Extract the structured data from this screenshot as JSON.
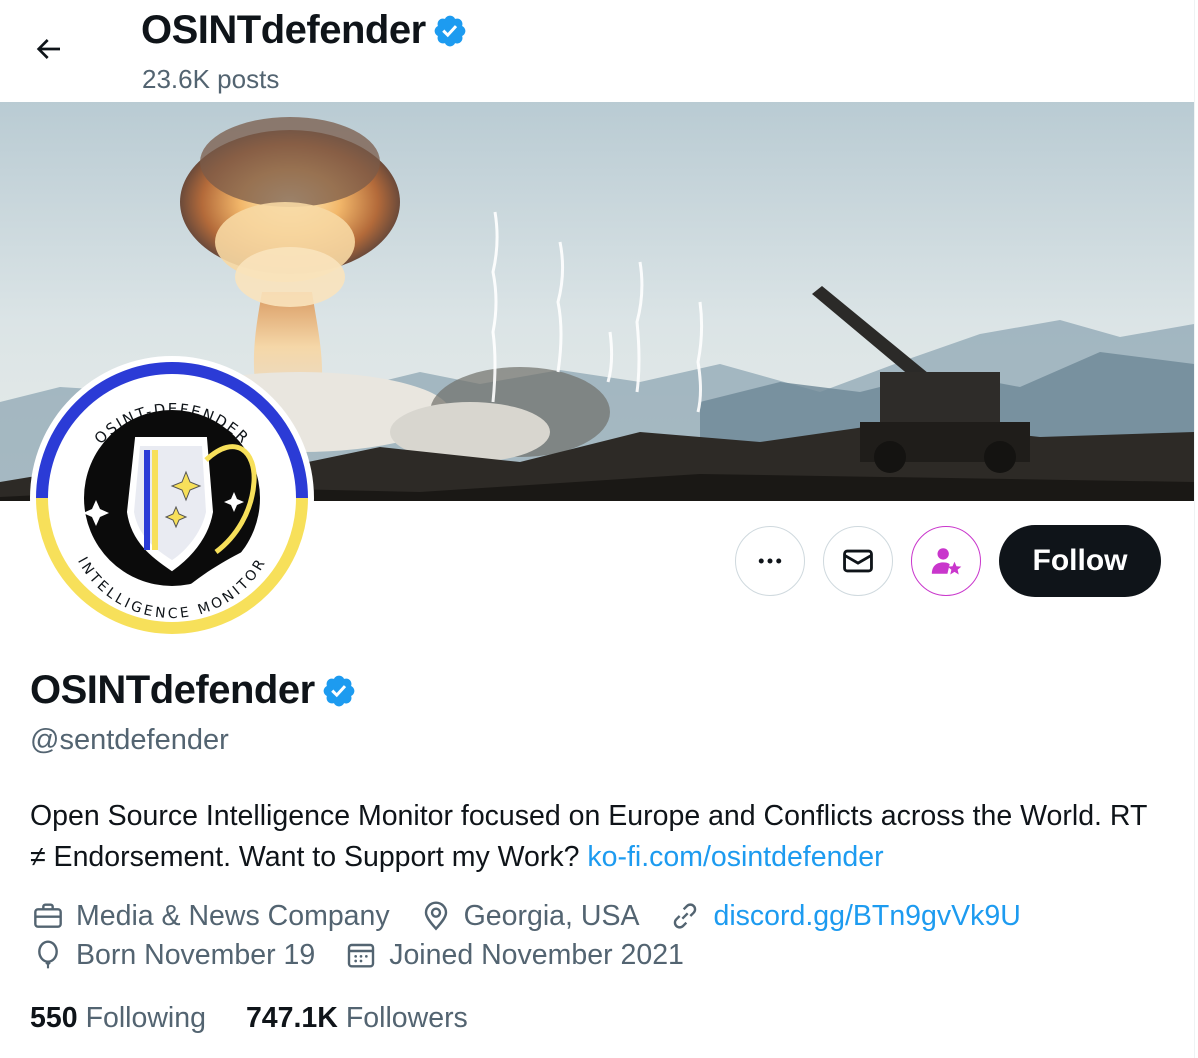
{
  "header": {
    "title": "OSINTdefender",
    "posts": "23.6K posts"
  },
  "profile": {
    "display_name": "OSINTdefender",
    "handle": "@sentdefender",
    "bio_text": "Open Source Intelligence Monitor focused on Europe and Conflicts across the World. RT ≠ Endorsement. Want to Support my Work? ",
    "bio_link": "ko-fi.com/osintdefender",
    "category": "Media & News Company",
    "location": "Georgia, USA",
    "website": "discord.gg/BTn9gvVk9U",
    "birthday": "Born November 19",
    "joined": "Joined November 2021"
  },
  "avatar_logo": {
    "top_arc": "OSINT-DEFENDER",
    "bottom_arc": "INTELLIGENCE MONITOR"
  },
  "stats": {
    "following_count": "550",
    "following_label": "Following",
    "followers_count": "747.1K",
    "followers_label": "Followers"
  },
  "actions": {
    "follow_label": "Follow"
  },
  "icons": {
    "back": "arrow-left-icon",
    "verified": "verified-badge-icon",
    "more": "more-dots-icon",
    "message": "envelope-icon",
    "subscribe": "person-star-icon",
    "category": "briefcase-icon",
    "location": "map-pin-icon",
    "website": "link-icon",
    "birthday": "balloon-icon",
    "joined": "calendar-icon"
  },
  "colors": {
    "accent": "#1d9bf0",
    "text": "#0f1419",
    "secondary": "#536471",
    "subscribe": "#c936cc",
    "verified": "#1d9bf0",
    "logo_blue": "#2b3bd6",
    "logo_yellow": "#f7e05a"
  }
}
